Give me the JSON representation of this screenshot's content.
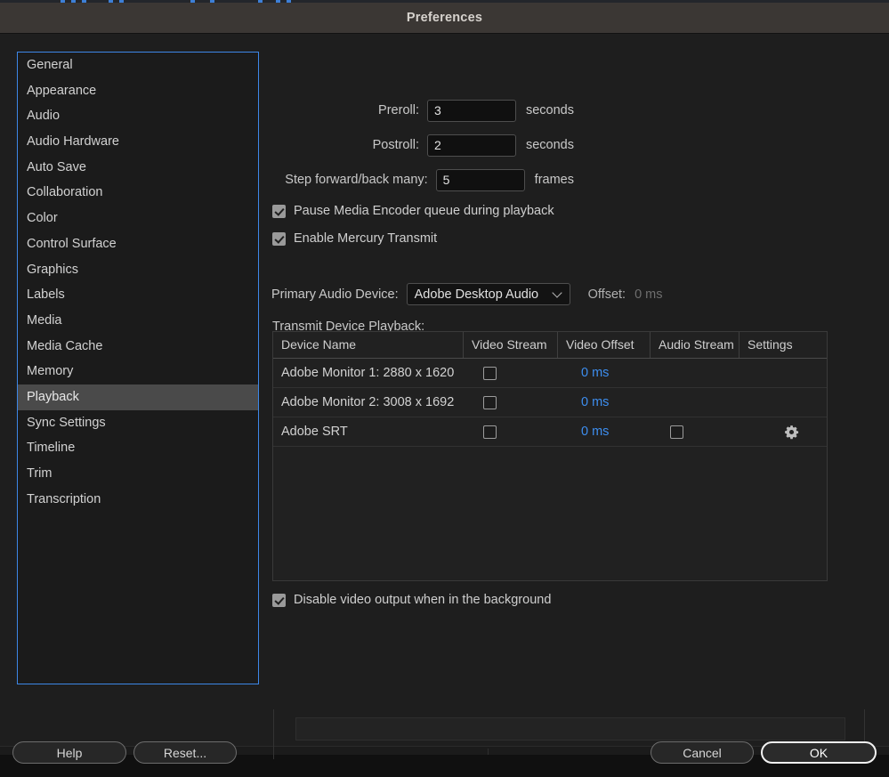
{
  "window": {
    "title": "Preferences"
  },
  "sidebar": {
    "items": [
      {
        "label": "General",
        "selected": false
      },
      {
        "label": "Appearance",
        "selected": false
      },
      {
        "label": "Audio",
        "selected": false
      },
      {
        "label": "Audio Hardware",
        "selected": false
      },
      {
        "label": "Auto Save",
        "selected": false
      },
      {
        "label": "Collaboration",
        "selected": false
      },
      {
        "label": "Color",
        "selected": false
      },
      {
        "label": "Control Surface",
        "selected": false
      },
      {
        "label": "Graphics",
        "selected": false
      },
      {
        "label": "Labels",
        "selected": false
      },
      {
        "label": "Media",
        "selected": false
      },
      {
        "label": "Media Cache",
        "selected": false
      },
      {
        "label": "Memory",
        "selected": false
      },
      {
        "label": "Playback",
        "selected": true
      },
      {
        "label": "Sync Settings",
        "selected": false
      },
      {
        "label": "Timeline",
        "selected": false
      },
      {
        "label": "Trim",
        "selected": false
      },
      {
        "label": "Transcription",
        "selected": false
      }
    ]
  },
  "playback": {
    "preroll": {
      "label": "Preroll:",
      "value": "3",
      "unit": "seconds"
    },
    "postroll": {
      "label": "Postroll:",
      "value": "2",
      "unit": "seconds"
    },
    "step": {
      "label": "Step forward/back many:",
      "value": "5",
      "unit": "frames"
    },
    "pause_encoder": {
      "label": "Pause Media Encoder queue during playback",
      "checked": true
    },
    "mercury_transmit": {
      "label": "Enable Mercury Transmit",
      "checked": true
    },
    "primary_audio_device": {
      "label": "Primary Audio Device:",
      "value": "Adobe Desktop Audio",
      "offset_label": "Offset:",
      "offset_value": "0 ms"
    },
    "transmit_caption": "Transmit Device Playback:",
    "table": {
      "columns": [
        "Device Name",
        "Video Stream",
        "Video Offset",
        "Audio Stream",
        "Settings"
      ],
      "rows": [
        {
          "device": "Adobe Monitor 1: 2880 x 1620",
          "video_stream": false,
          "video_offset": "0 ms",
          "audio_stream": null,
          "settings": false
        },
        {
          "device": "Adobe Monitor 2: 3008 x 1692",
          "video_stream": false,
          "video_offset": "0 ms",
          "audio_stream": null,
          "settings": false
        },
        {
          "device": "Adobe SRT",
          "video_stream": false,
          "video_offset": "0 ms",
          "audio_stream": false,
          "settings": true
        }
      ]
    },
    "disable_video_background": {
      "label": "Disable video output when in the background",
      "checked": true
    }
  },
  "footer": {
    "help": "Help",
    "reset": "Reset...",
    "cancel": "Cancel",
    "ok": "OK"
  },
  "colors": {
    "accent": "#3d87e8",
    "link": "#3d8ef0",
    "titlebar": "#3b3734",
    "panel": "#1e1e1e",
    "selection": "#4a4a4a"
  }
}
